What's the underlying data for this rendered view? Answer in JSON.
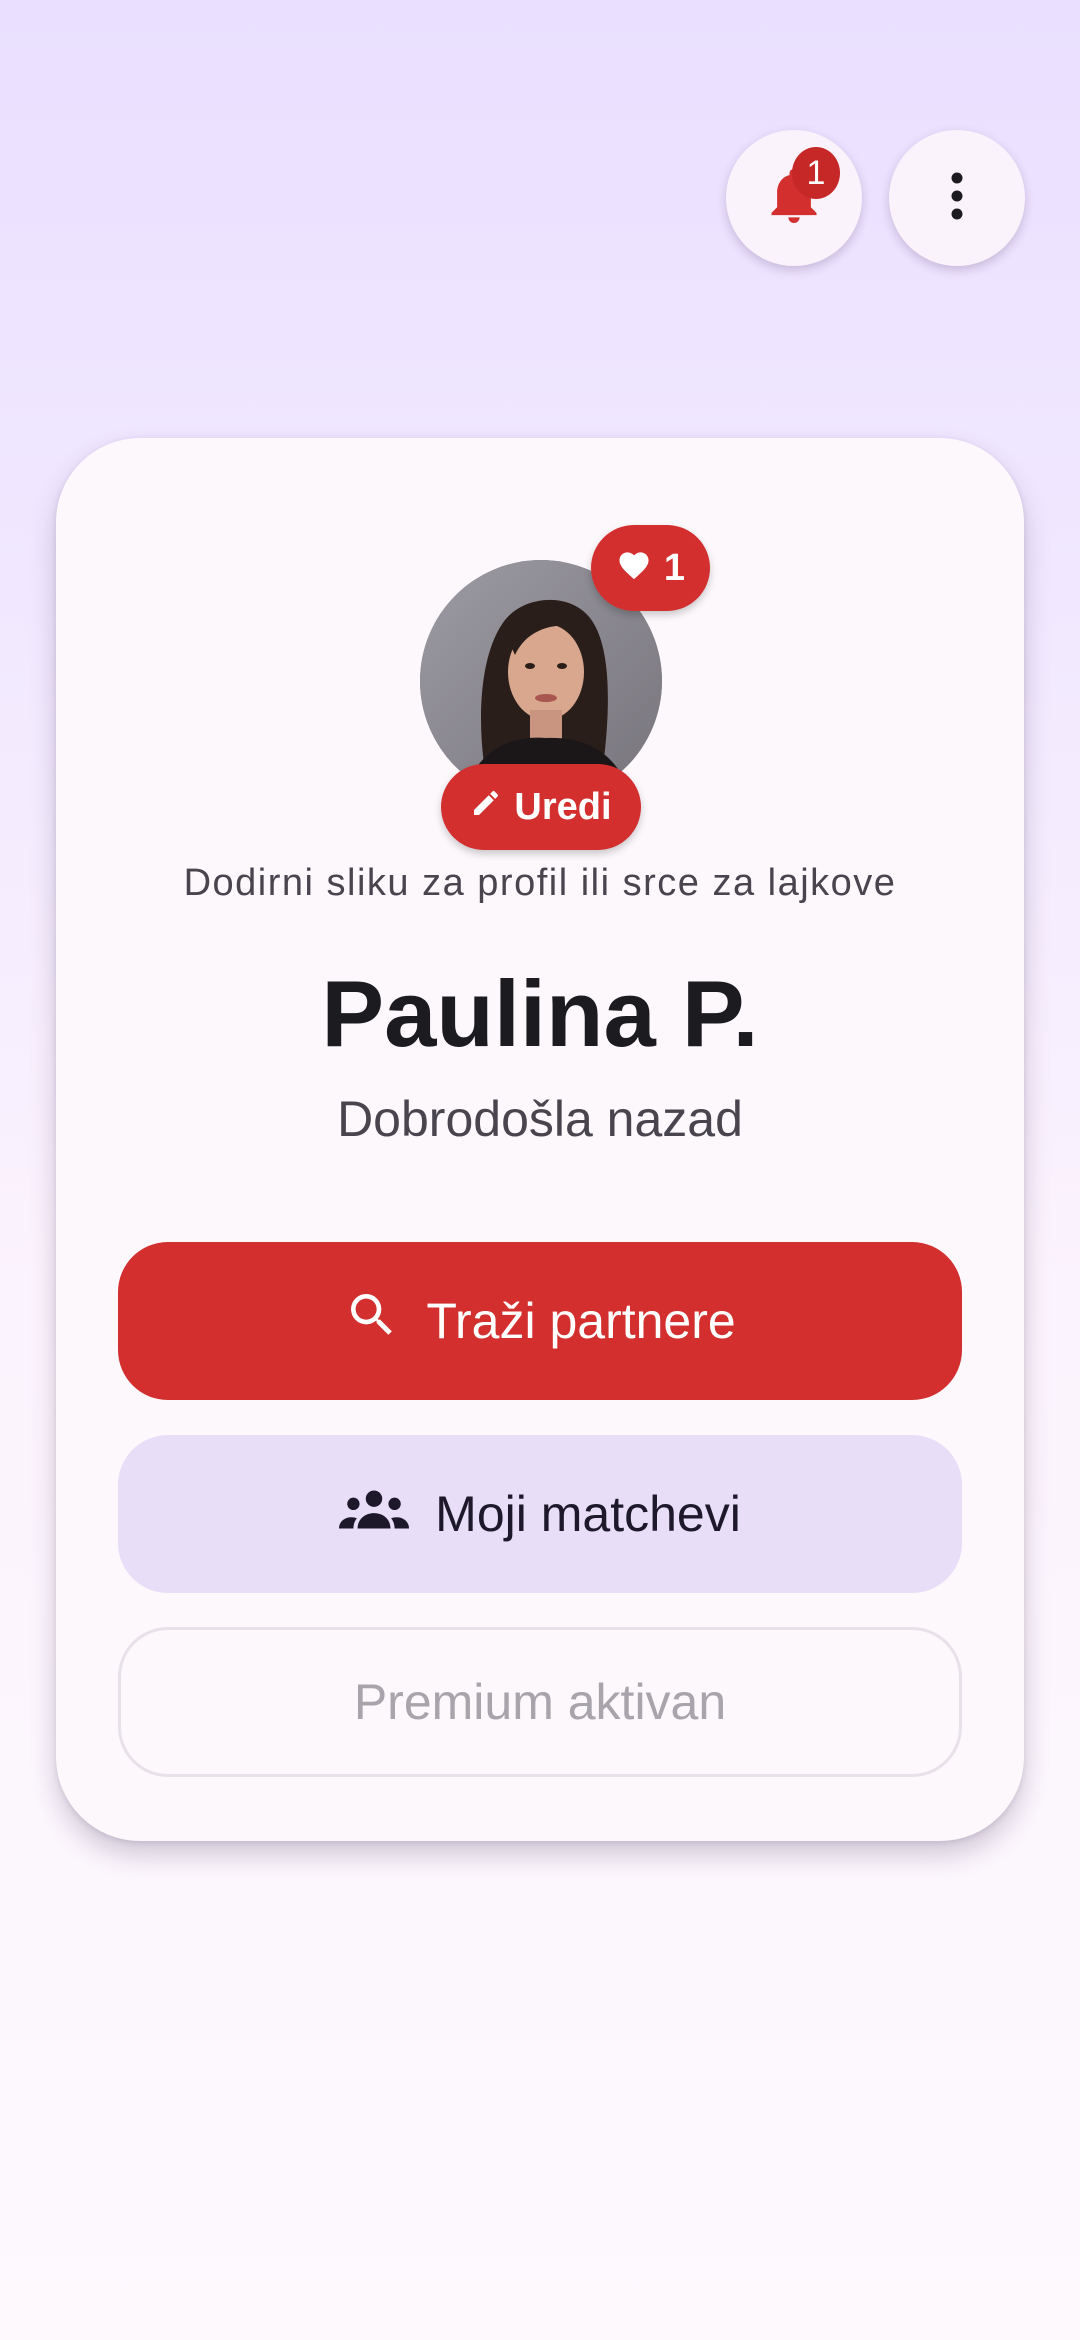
{
  "top_bar": {
    "bell_icon": "bell-icon",
    "notification_count": "1",
    "more_icon": "more-vert-icon"
  },
  "profile": {
    "likes_icon": "heart-icon",
    "likes_count": "1",
    "edit_icon": "pencil-icon",
    "edit_label": "Uredi",
    "hint": "Dodirni sliku za profil ili srce za lajkove",
    "name": "Paulina P.",
    "greeting": "Dobrodošla nazad"
  },
  "actions": {
    "search_icon": "search-icon",
    "search_label": "Traži partnere",
    "matches_icon": "group-icon",
    "matches_label": "Moji matchevi",
    "premium_label": "Premium aktivan"
  },
  "colors": {
    "accent": "#D32F2F",
    "secondary_container": "#E8DEF8",
    "card": "#FCF8FC"
  }
}
